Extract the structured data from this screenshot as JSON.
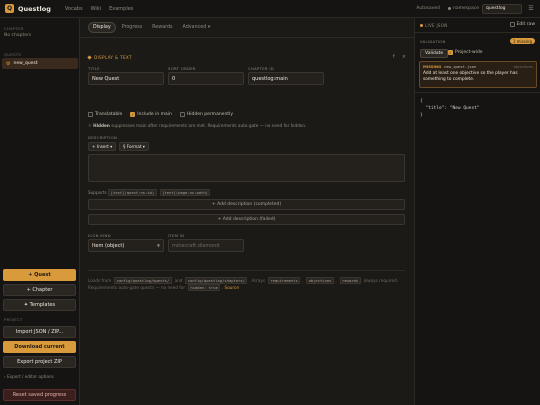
{
  "app": {
    "name": "Questlog",
    "logo_glyph": "Q"
  },
  "nav": [
    "Vocabs",
    "Wiki",
    "Examples"
  ],
  "topbar": {
    "autosaved": "Autosaved",
    "namespace_label": "namespace",
    "namespace_value": "questlog",
    "menu_glyph": "☰"
  },
  "sidebar": {
    "chapter_label": "CHAPTER",
    "no_chapters": "No chapters",
    "quests_label": "QUESTS",
    "quest_item": "new_quest",
    "btn_quest": "+ Quest",
    "btn_chapter": "+ Chapter",
    "btn_templates": "✦ Templates",
    "project_label": "PROJECT",
    "btn_import": "Import JSON / ZIP...",
    "btn_download": "Download current",
    "btn_export": "Export project ZIP",
    "export_options": "› Export / editor options",
    "btn_reset": "Reset saved progress"
  },
  "tabs": [
    "Display",
    "Progress",
    "Rewards",
    "Advanced ▾"
  ],
  "section": {
    "title": "DISPLAY & TEXT",
    "tool_up": "↑",
    "tool_close": "×"
  },
  "fields": {
    "title_label": "TITLE",
    "title_value": "New Quest",
    "sort_label": "SORT ORDER",
    "sort_value": "0",
    "chapter_label": "CHAPTER ID",
    "chapter_value": "questlog:main",
    "icon_kind_label": "ICON KIND",
    "icon_kind_value": "Item (object)",
    "item_id_label": "ITEM ID",
    "item_id_placeholder": "minecraft:diamond"
  },
  "checks": [
    {
      "label": "Translatable",
      "checked": false
    },
    {
      "label": "Include in main",
      "checked": true
    },
    {
      "label": "Hidden permanently",
      "checked": false
    }
  ],
  "hint": {
    "prefix": "☼",
    "bold": "Hidden",
    "rest": "suppresses main after requirements are met. Requirements auto-gate — no need for hidden."
  },
  "description": {
    "label": "DESCRIPTION",
    "insert_btn": "+ Insert ▾",
    "format_btn": "§ Format ▾",
    "supports_prefix": "Supports",
    "code1": "[text](quest:ns:id)",
    "code2": "[text](page:ns:path)",
    "add_completed": "+ Add description (completed)",
    "add_failed": "+ Add description (failed)"
  },
  "footer": {
    "p1": "Loads from",
    "c1": "config/questlog/quests/",
    "p2": "and",
    "c2": "config/questlog/chapters/",
    "p3": ". Arrays",
    "c3": "requirements",
    "p4": ",",
    "c4": "objectives",
    "p5": ",",
    "c5": "rewards",
    "p6": "always required.",
    "p7": "Requirements auto-gate quests — no need for",
    "c6": "hidden: true",
    "p8": ".",
    "link": "Source"
  },
  "right": {
    "live_json": "LIVE JSON",
    "edit_raw": "Edit raw",
    "validation_label": "VALIDATION",
    "missing_badge": "1 missing",
    "validate_btn": "Validate",
    "project_wide": "Project-wide",
    "msg_tag": "MISSING",
    "msg_file": "new_quest.json",
    "msg_sev": "objectives",
    "msg_text": "Add at least one objective so the player has something to complete.",
    "json_text": "{\n  \"title\": \"New Quest\"\n}"
  },
  "colors": {
    "accent": "#d99a3c",
    "background": "#1c1a17",
    "panel": "#161412"
  }
}
